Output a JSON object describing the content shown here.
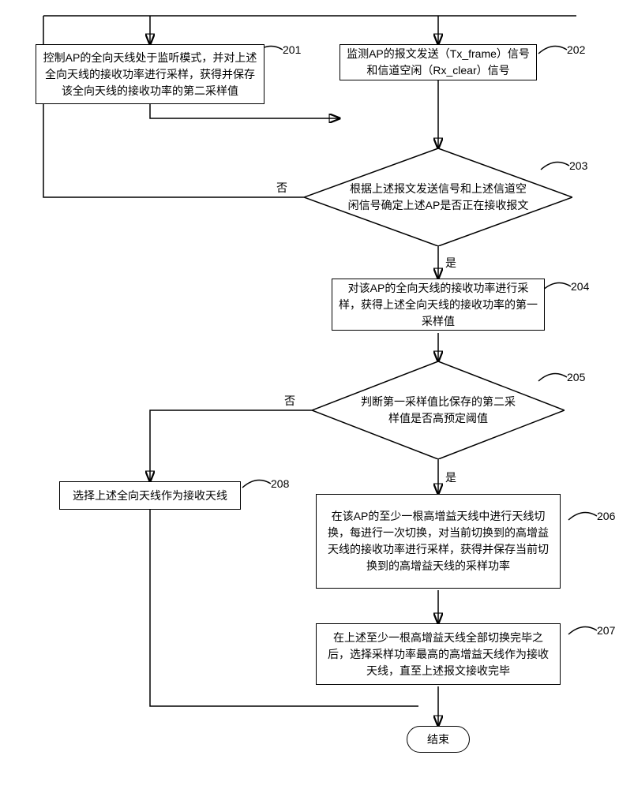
{
  "steps": {
    "s201": "控制AP的全向天线处于监听模式，并对上述全向天线的接收功率进行采样，获得并保存该全向天线的接收功率的第二采样值",
    "s202": "监测AP的报文发送（Tx_frame）信号和信道空闲（Rx_clear）信号",
    "s203": "根据上述报文发送信号和上述信道空闲信号确定上述AP是否正在接收报文",
    "s204": "对该AP的全向天线的接收功率进行采样，获得上述全向天线的接收功率的第一采样值",
    "s205": "判断第一采样值比保存的第二采样值是否高预定阈值",
    "s206": "在该AP的至少一根高增益天线中进行天线切换，每进行一次切换，对当前切换到的高增益天线的接收功率进行采样，获得并保存当前切换到的高增益天线的采样功率",
    "s207": "在上述至少一根高增益天线全部切换完毕之后，选择采样功率最高的高增益天线作为接收天线，直至上述报文接收完毕",
    "s208": "选择上述全向天线作为接收天线",
    "end": "结束"
  },
  "labels": {
    "yes": "是",
    "no": "否",
    "n201": "201",
    "n202": "202",
    "n203": "203",
    "n204": "204",
    "n205": "205",
    "n206": "206",
    "n207": "207",
    "n208": "208"
  }
}
